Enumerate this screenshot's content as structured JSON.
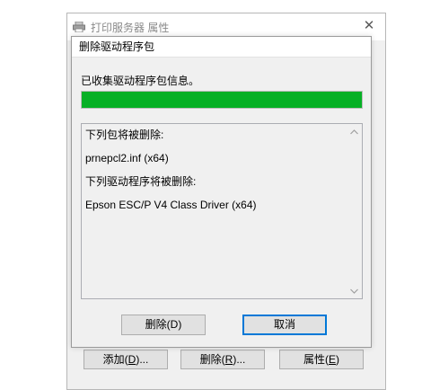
{
  "background_window": {
    "title": "打印服务器 属性",
    "close_symbol": "✕",
    "buttons": {
      "add_prefix": "添加(",
      "add_key": "D",
      "add_suffix": ")...",
      "remove_prefix": "删除(",
      "remove_key": "R",
      "remove_suffix": ")...",
      "props_prefix": "属性(",
      "props_key": "E",
      "props_suffix": ")"
    }
  },
  "dialog": {
    "title": "删除驱动程序包",
    "status_text": "已收集驱动程序包信息。",
    "progress_fraction": 1.0,
    "progress_color": "#06b025",
    "list_lines": [
      "下列包将被删除:",
      "prnepcl2.inf (x64)",
      "下列驱动程序将被删除:",
      "Epson ESC/P V4 Class Driver (x64)"
    ],
    "buttons": {
      "delete": "删除(D)",
      "cancel": "取消"
    }
  },
  "icons": {
    "printer": "printer-icon",
    "scroll_up": "chevron-up-icon",
    "scroll_down": "chevron-down-icon",
    "close": "close-icon"
  }
}
